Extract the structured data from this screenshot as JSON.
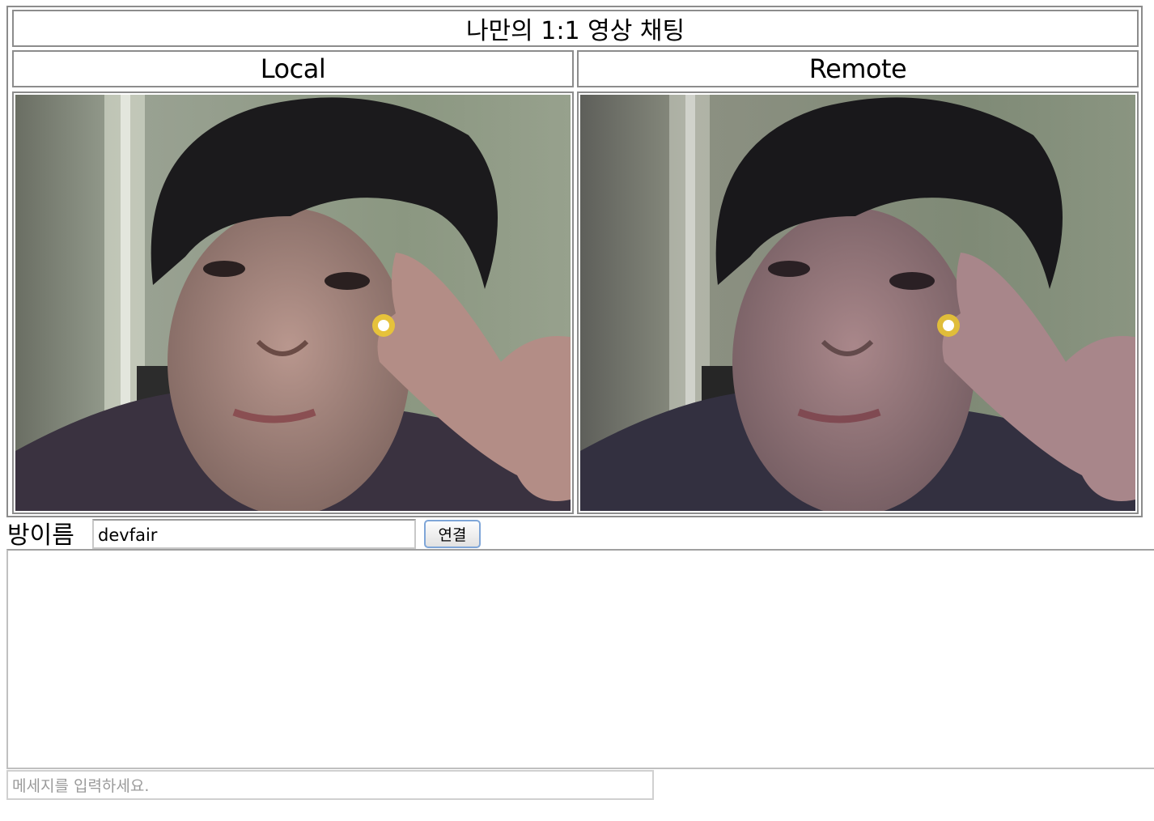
{
  "page": {
    "title": "나만의 1:1 영상 채팅"
  },
  "videos": {
    "local": {
      "label": "Local",
      "icon": "person-video-icon"
    },
    "remote": {
      "label": "Remote",
      "icon": "person-video-icon"
    }
  },
  "room": {
    "label": "방이름",
    "value": "devfair",
    "connect_label": "연결"
  },
  "chat": {
    "log_text": "",
    "placeholder": "메세지를 입력하세요."
  }
}
